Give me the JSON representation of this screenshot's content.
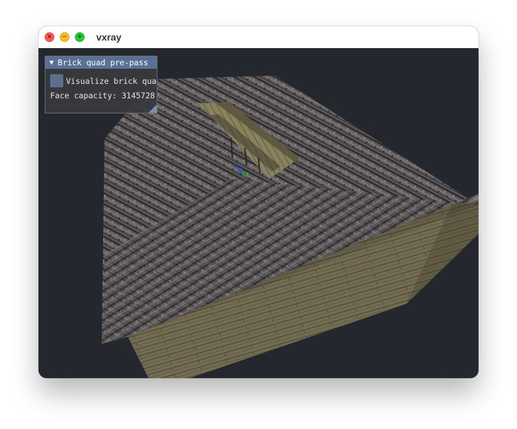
{
  "window": {
    "title": "vxray",
    "controls": {
      "close": "×",
      "minimize": "−",
      "maximize": "+"
    }
  },
  "panel": {
    "title": "Brick quad pre-pass",
    "collapse_icon": "triangle-down-icon",
    "collapse_glyph": "▼",
    "checkbox_label": "Visualize brick quads",
    "checkbox_checked": false,
    "face_capacity": "Face capacity: 3145728"
  },
  "colors": {
    "background": "#24272d",
    "panel_header": "#5a7196",
    "checkbox": "#5c6f8c"
  }
}
